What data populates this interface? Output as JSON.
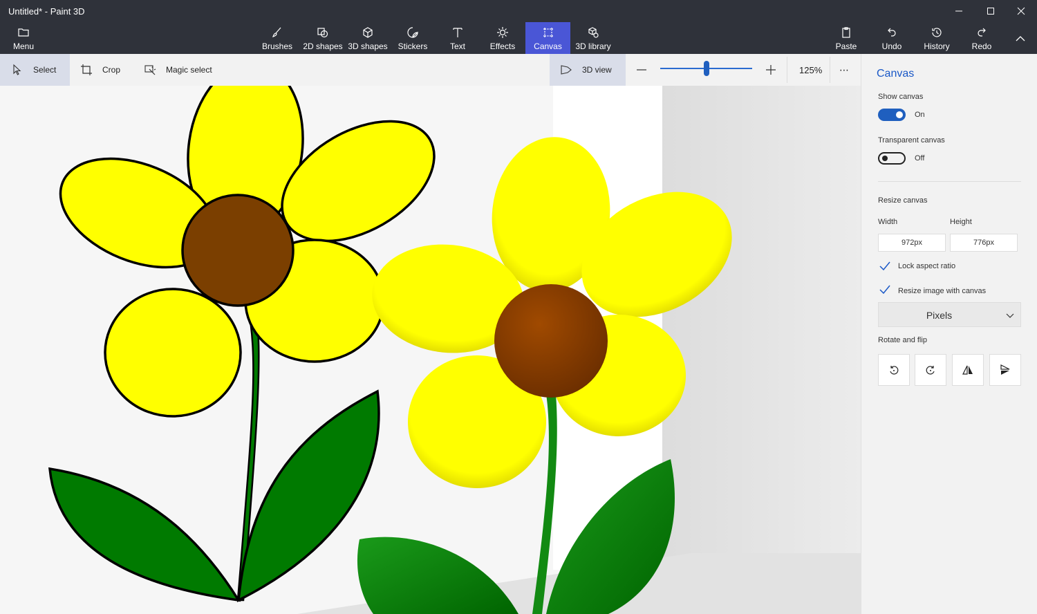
{
  "window": {
    "title": "Untitled* - Paint 3D"
  },
  "ribbon": {
    "menu": "Menu",
    "tools": [
      {
        "label": "Brushes",
        "icon": "brush-icon"
      },
      {
        "label": "2D shapes",
        "icon": "2d-shapes-icon"
      },
      {
        "label": "3D shapes",
        "icon": "3d-shapes-icon"
      },
      {
        "label": "Stickers",
        "icon": "stickers-icon"
      },
      {
        "label": "Text",
        "icon": "text-icon"
      },
      {
        "label": "Effects",
        "icon": "effects-icon"
      },
      {
        "label": "Canvas",
        "icon": "canvas-icon",
        "active": true
      },
      {
        "label": "3D library",
        "icon": "3d-library-icon"
      }
    ],
    "actions": {
      "paste": "Paste",
      "undo": "Undo",
      "history": "History",
      "redo": "Redo"
    }
  },
  "toolbar": {
    "select": "Select",
    "crop": "Crop",
    "magic_select": "Magic select",
    "view_3d": "3D view",
    "zoom_level": "125%",
    "zoom_fraction": 0.5,
    "more": "⋯"
  },
  "panel": {
    "title": "Canvas",
    "show_canvas": {
      "label": "Show canvas",
      "state": "On"
    },
    "transparent_canvas": {
      "label": "Transparent canvas",
      "state": "Off"
    },
    "resize_title": "Resize canvas",
    "width_label": "Width",
    "height_label": "Height",
    "width_value": "972px",
    "height_value": "776px",
    "lock_aspect": "Lock aspect ratio",
    "resize_image": "Resize image with canvas",
    "units": "Pixels",
    "rotate_flip": "Rotate and flip"
  },
  "colors": {
    "chrome": "#2f323a",
    "accent": "#1f5fbf",
    "active_tool": "#4a56d6",
    "petal_yellow": "#ffff00",
    "flower_center": "#7b3f00",
    "leaf_green": "#007a00"
  }
}
